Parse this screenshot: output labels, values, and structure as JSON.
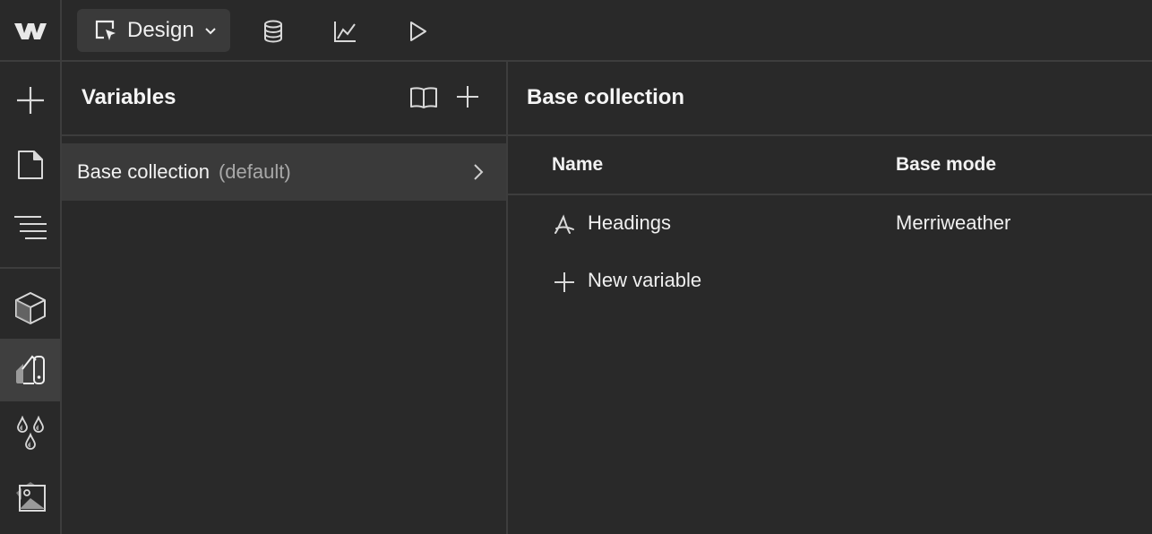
{
  "app": {
    "logo_icon": "webflow-logo-icon",
    "mode_button": {
      "label": "Design",
      "icon": "design-cursor-icon"
    },
    "toolbar_icons": [
      "cms-database-icon",
      "analyze-chart-icon",
      "preview-play-icon"
    ]
  },
  "left_sidebar": {
    "items": [
      {
        "name": "add-icon",
        "active": false
      },
      {
        "name": "pages-icon",
        "active": false
      },
      {
        "name": "navigator-icon",
        "active": false
      },
      {
        "name": "components-icon",
        "active": false
      },
      {
        "name": "variables-icon",
        "active": true
      },
      {
        "name": "styles-icon",
        "active": false
      },
      {
        "name": "assets-icon",
        "active": false
      }
    ]
  },
  "variables_panel": {
    "title": "Variables",
    "actions": [
      "book-icon",
      "plus-icon"
    ],
    "collections": [
      {
        "name": "Base collection",
        "tag": "(default)",
        "selected": true
      }
    ]
  },
  "collection_view": {
    "title": "Base collection",
    "columns": [
      "Name",
      "Base mode"
    ],
    "rows": [
      {
        "icon": "font-icon",
        "name": "Headings",
        "base_mode": "Merriweather"
      }
    ],
    "new_variable_label": "New variable"
  },
  "colors": {
    "background": "#292929",
    "border": "#3d3d3d",
    "selected_row": "#3a3a3a",
    "text": "#f2f2f2",
    "muted_text": "#a8a8a8"
  }
}
